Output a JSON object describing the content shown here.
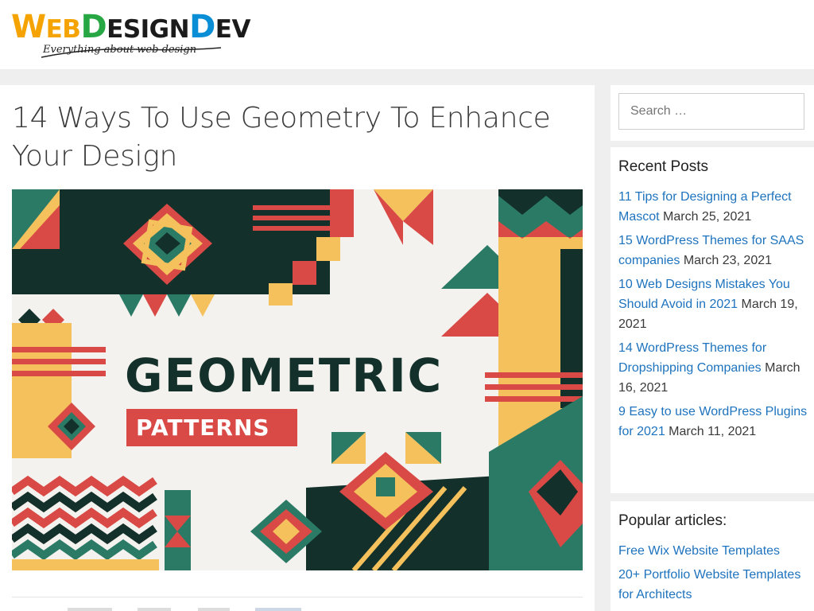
{
  "header": {
    "logo": {
      "part1_initial": "W",
      "part1_rest": "EB",
      "part2_initial": "D",
      "part2_rest": "ESIGN",
      "part3_initial": "D",
      "part3_rest": "EV",
      "tagline": "Everything about web design"
    }
  },
  "article": {
    "title": "14 Ways To Use Geometry To Enhance Your Design",
    "image": {
      "headline": "GEOMETRIC",
      "subheadline": "PATTERNS"
    }
  },
  "sidebar": {
    "search": {
      "placeholder": "Search …"
    },
    "recent_posts": {
      "title": "Recent Posts",
      "items": [
        {
          "title": "11 Tips for Designing a Perfect Mascot",
          "date": "March 25, 2021"
        },
        {
          "title": "15 WordPress Themes for SAAS companies",
          "date": "March 23, 2021"
        },
        {
          "title": "10 Web Designs Mistakes You Should Avoid in 2021",
          "date": "March 19, 2021"
        },
        {
          "title": "14 WordPress Themes for Dropshipping Companies",
          "date": "March 16, 2021"
        },
        {
          "title": "9 Easy to use WordPress Plugins for 2021",
          "date": "March 11, 2021"
        }
      ]
    },
    "popular": {
      "title": "Popular articles:",
      "items": [
        {
          "title": "Free Wix Website Templates"
        },
        {
          "title": "20+ Portfolio Website Templates for Architects"
        }
      ]
    }
  },
  "colors": {
    "link": "#1e73be",
    "pattern_red": "#d94a46",
    "pattern_dark": "#14302a",
    "pattern_teal": "#2b7a66",
    "pattern_yellow": "#f5c15c"
  }
}
